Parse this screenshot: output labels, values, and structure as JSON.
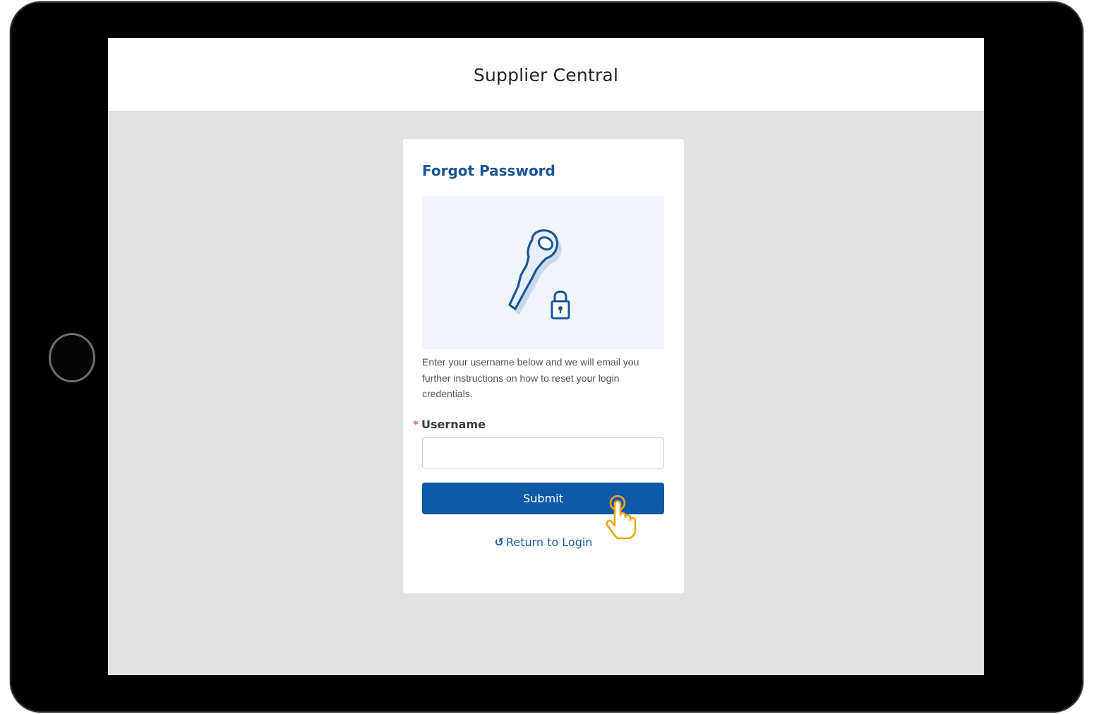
{
  "header": {
    "title": "Supplier Central"
  },
  "card": {
    "title": "Forgot Password",
    "illustration_icon": "key-lock-icon",
    "description": "Enter your username below and we will email you further instructions on how to reset your login credentials.",
    "username_label": "Username",
    "required_marker": "*",
    "username_value": "",
    "submit_label": "Submit",
    "return_label": "Return to Login",
    "return_icon": "undo-icon"
  },
  "colors": {
    "brand_blue": "#0f5aa8",
    "title_blue": "#1a5594",
    "required_red": "#c23934",
    "cursor_orange": "#f2a516"
  }
}
